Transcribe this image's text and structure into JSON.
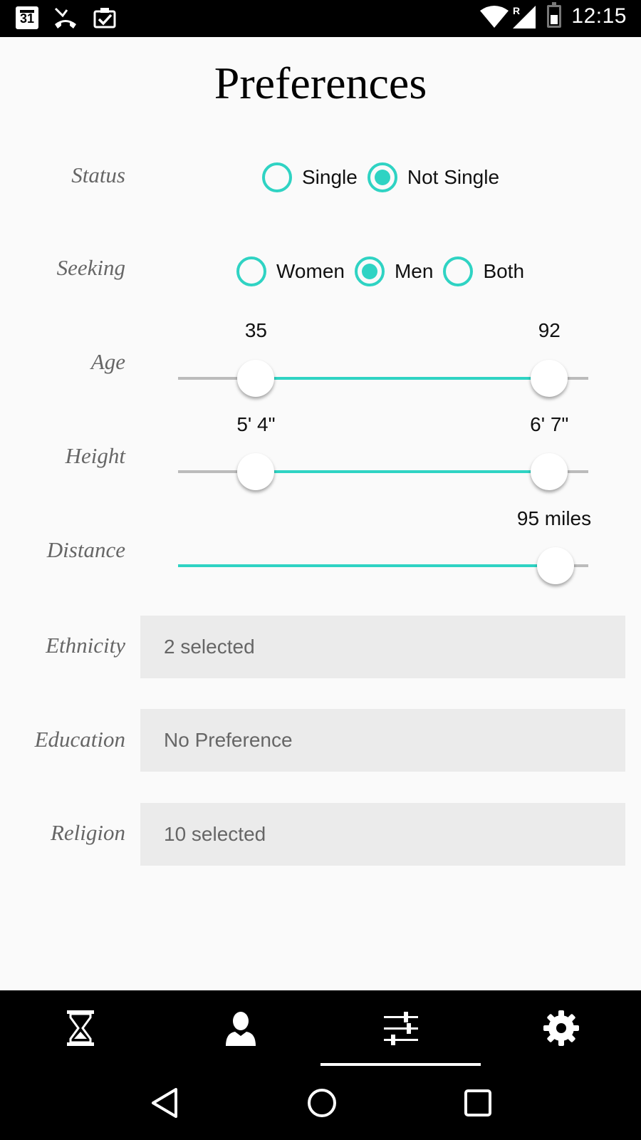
{
  "status_bar": {
    "calendar_day": "31",
    "roaming": "R",
    "time": "12:15"
  },
  "page": {
    "title": "Preferences"
  },
  "status": {
    "label": "Status",
    "options": [
      {
        "label": "Single",
        "selected": false
      },
      {
        "label": "Not Single",
        "selected": true
      }
    ]
  },
  "seeking": {
    "label": "Seeking",
    "options": [
      {
        "label": "Women",
        "selected": false
      },
      {
        "label": "Men",
        "selected": true
      },
      {
        "label": "Both",
        "selected": false
      }
    ]
  },
  "age": {
    "label": "Age",
    "min_label": "35",
    "max_label": "92",
    "range_low_fraction": 0.19,
    "range_high_fraction": 0.905
  },
  "height": {
    "label": "Height",
    "min_label": "5' 4\"",
    "max_label": "6' 7\"",
    "range_low_fraction": 0.19,
    "range_high_fraction": 0.905
  },
  "distance": {
    "label": "Distance",
    "value_label": "95 miles",
    "value_fraction": 0.92
  },
  "ethnicity": {
    "label": "Ethnicity",
    "value": "2 selected"
  },
  "education": {
    "label": "Education",
    "value": "No Preference"
  },
  "religion": {
    "label": "Religion",
    "value": "10 selected"
  },
  "bottom_nav": {
    "items": [
      {
        "icon": "hourglass-icon",
        "active": false
      },
      {
        "icon": "profile-icon",
        "active": false
      },
      {
        "icon": "sliders-icon",
        "active": true
      },
      {
        "icon": "gear-icon",
        "active": false
      }
    ]
  },
  "colors": {
    "accent": "#2fd3c3",
    "track": "#bbbbbb",
    "select_bg": "#ebebeb",
    "bar_bg": "#000000"
  }
}
